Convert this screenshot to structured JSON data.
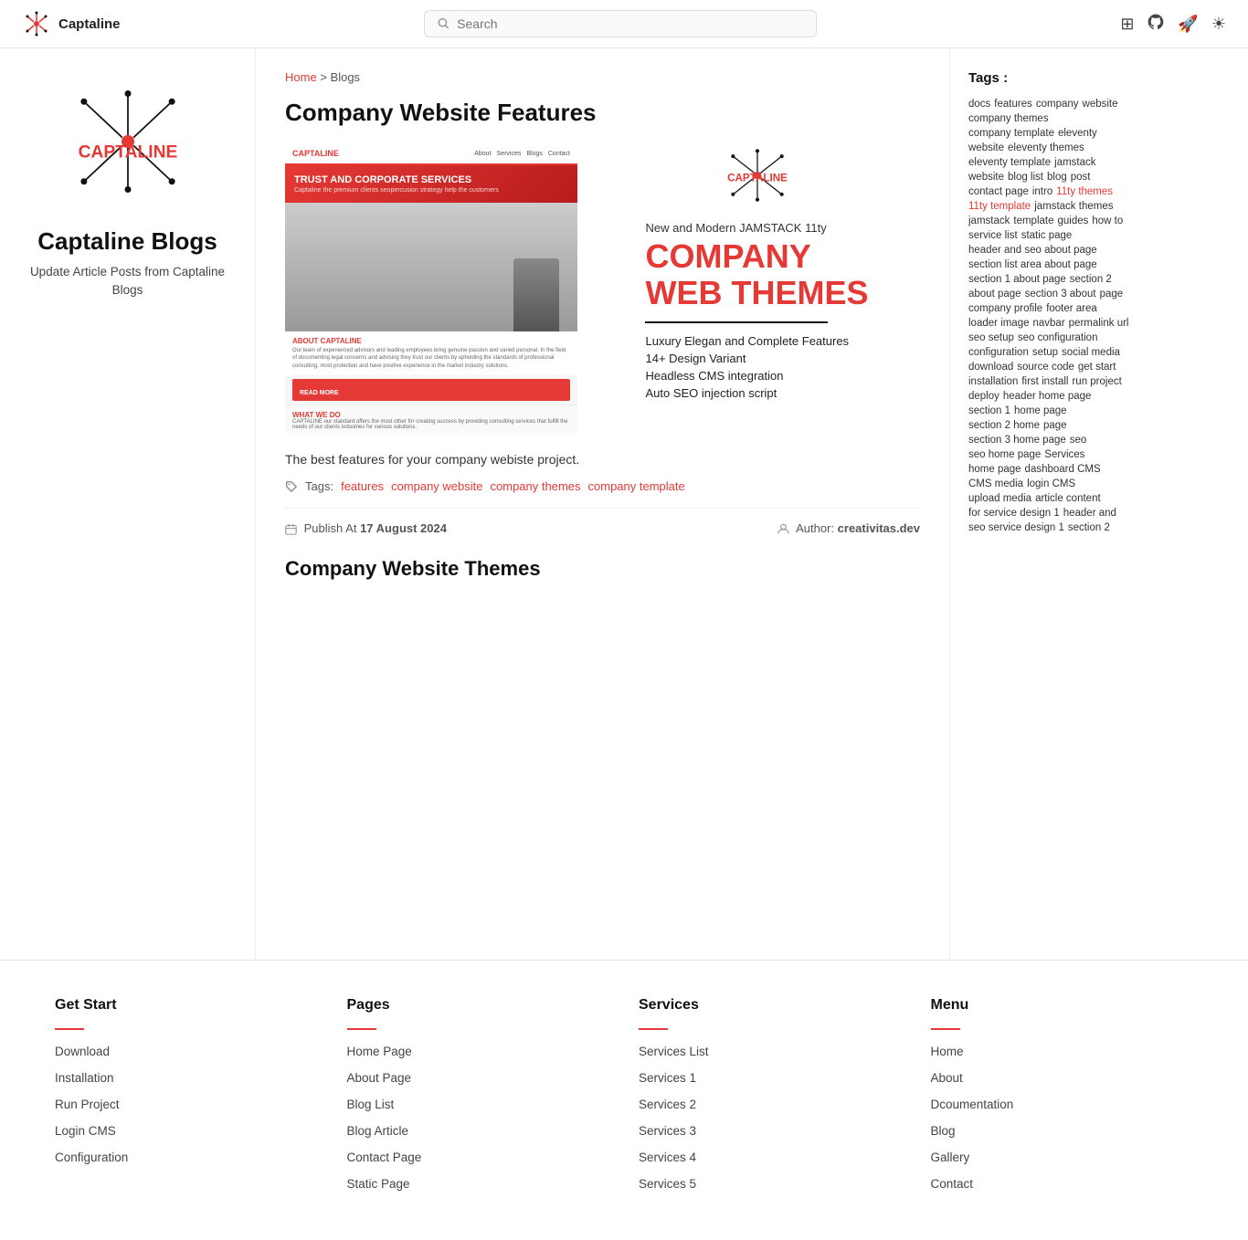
{
  "header": {
    "brand": "Captaline",
    "search_placeholder": "Search",
    "icons": [
      "grid-icon",
      "github-icon",
      "rocket-icon",
      "sun-icon"
    ]
  },
  "sidebar": {
    "title": "Captaline Blogs",
    "subtitle": "Update Article Posts from Captaline Blogs"
  },
  "breadcrumb": {
    "home": "Home",
    "separator": ">",
    "current": "Blogs"
  },
  "article1": {
    "title": "Company Website Features",
    "description": "The best features for your company webiste project.",
    "tags_label": "Tags:",
    "tags": [
      "features",
      "company website",
      "company themes",
      "company template"
    ],
    "publish_label": "Publish At",
    "publish_date": "17 August 2024",
    "author_label": "Author:",
    "author": "creativitas.dev",
    "right_subtitle": "New and Modern JAMSTACK 11ty",
    "right_title_line1": "COMPANY",
    "right_title_line2": "WEB THEMES",
    "features": [
      "Luxury Elegan and Complete Features",
      "14+ Design Variant",
      "Headless CMS integration",
      "Auto SEO injection script"
    ]
  },
  "article2": {
    "title": "Company Website Themes"
  },
  "tags": {
    "label": "Tags :",
    "items": [
      {
        "text": "docs",
        "red": false
      },
      {
        "text": "features",
        "red": false
      },
      {
        "text": "company",
        "red": false
      },
      {
        "text": "website",
        "red": false
      },
      {
        "text": "company themes",
        "red": false
      },
      {
        "text": "company template",
        "red": false
      },
      {
        "text": "eleventy",
        "red": false
      },
      {
        "text": "website",
        "red": false
      },
      {
        "text": "eleventy themes",
        "red": false
      },
      {
        "text": "eleventy template",
        "red": false
      },
      {
        "text": "jamstack",
        "red": false
      },
      {
        "text": "website",
        "red": false
      },
      {
        "text": "blog list",
        "red": false
      },
      {
        "text": "blog",
        "red": false
      },
      {
        "text": "post",
        "red": false
      },
      {
        "text": "contact page",
        "red": false
      },
      {
        "text": "intro",
        "red": false
      },
      {
        "text": "11ty themes",
        "red": true
      },
      {
        "text": "11ty template",
        "red": true
      },
      {
        "text": "jamstack themes",
        "red": false
      },
      {
        "text": "jamstack",
        "red": false
      },
      {
        "text": "template",
        "red": false
      },
      {
        "text": "guides",
        "red": false
      },
      {
        "text": "how to",
        "red": false
      },
      {
        "text": "service list",
        "red": false
      },
      {
        "text": "static page",
        "red": false
      },
      {
        "text": "header and seo about page",
        "red": false
      },
      {
        "text": "section list area about page",
        "red": false
      },
      {
        "text": "section 1 about page",
        "red": false
      },
      {
        "text": "section 2",
        "red": false
      },
      {
        "text": "about page",
        "red": false
      },
      {
        "text": "section 3 about",
        "red": false
      },
      {
        "text": "page",
        "red": false
      },
      {
        "text": "company profile",
        "red": false
      },
      {
        "text": "footer area",
        "red": false
      },
      {
        "text": "loader image",
        "red": false
      },
      {
        "text": "navbar",
        "red": false
      },
      {
        "text": "permalink url",
        "red": false
      },
      {
        "text": "seo setup",
        "red": false
      },
      {
        "text": "seo configuration",
        "red": false
      },
      {
        "text": "configuration",
        "red": false
      },
      {
        "text": "setup",
        "red": false
      },
      {
        "text": "social media",
        "red": false
      },
      {
        "text": "download",
        "red": false
      },
      {
        "text": "source code",
        "red": false
      },
      {
        "text": "get start",
        "red": false
      },
      {
        "text": "installation",
        "red": false
      },
      {
        "text": "first install",
        "red": false
      },
      {
        "text": "run project",
        "red": false
      },
      {
        "text": "deploy",
        "red": false
      },
      {
        "text": "header home page",
        "red": false
      },
      {
        "text": "section 1",
        "red": false
      },
      {
        "text": "home page",
        "red": false
      },
      {
        "text": "section 2 home",
        "red": false
      },
      {
        "text": "page",
        "red": false
      },
      {
        "text": "section 3 home page",
        "red": false
      },
      {
        "text": "seo",
        "red": false
      },
      {
        "text": "seo home page",
        "red": false
      },
      {
        "text": "Services",
        "red": false
      },
      {
        "text": "home page",
        "red": false
      },
      {
        "text": "dashboard CMS",
        "red": false
      },
      {
        "text": "CMS media",
        "red": false
      },
      {
        "text": "login CMS",
        "red": false
      },
      {
        "text": "upload media",
        "red": false
      },
      {
        "text": "article content",
        "red": false
      },
      {
        "text": "for service design 1",
        "red": false
      },
      {
        "text": "header and",
        "red": false
      },
      {
        "text": "seo service design 1",
        "red": false
      },
      {
        "text": "section 2",
        "red": false
      }
    ]
  },
  "footer": {
    "col1": {
      "title": "Get Start",
      "links": [
        "Download",
        "Installation",
        "Run Project",
        "Login CMS",
        "Configuration"
      ]
    },
    "col2": {
      "title": "Pages",
      "links": [
        "Home Page",
        "About Page",
        "Blog List",
        "Blog Article",
        "Contact Page",
        "Static Page"
      ]
    },
    "col3": {
      "title": "Services",
      "links": [
        "Services List",
        "Services 1",
        "Services 2",
        "Services 3",
        "Services 4",
        "Services 5"
      ]
    },
    "col4": {
      "title": "Menu",
      "links": [
        "Home",
        "About",
        "Dcoumentation",
        "Blog",
        "Gallery",
        "Contact"
      ]
    }
  }
}
